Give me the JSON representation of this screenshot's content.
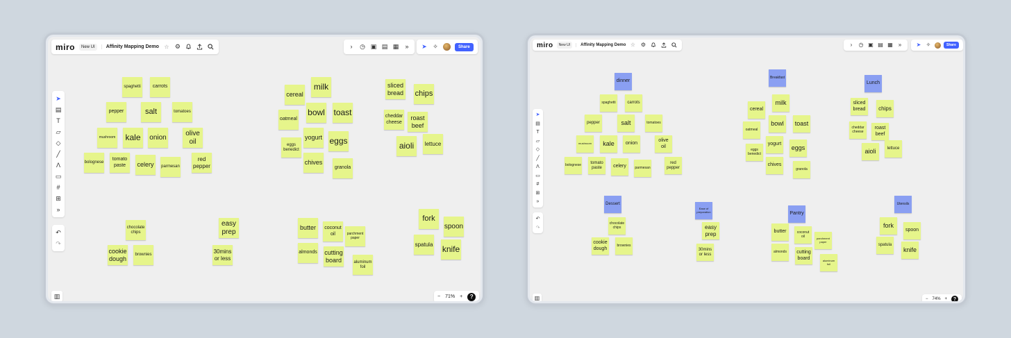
{
  "app": {
    "logo": "miro",
    "tag": "New UI",
    "board_title": "Affinity Mapping Demo",
    "share_label": "Share"
  },
  "icons": {
    "star": "☆",
    "settings": "⚙",
    "bell": "🔔",
    "upload": "⇪",
    "search": "⌕",
    "chevron_right": "›",
    "timer": "◷",
    "present": "▣",
    "comment": "▤",
    "notes": "▦",
    "more": "»",
    "cursor": "➤",
    "celebrate": "✧",
    "panel": "▥",
    "minus": "−",
    "plus": "+",
    "help": "?"
  },
  "colors": {
    "sticky_yellow": "#e6f58b",
    "sticky_blue": "#8a9ff2",
    "share_blue": "#4262ff",
    "canvas": "#efefef"
  },
  "tools": [
    "select",
    "frame",
    "text",
    "sticky-note",
    "shapes",
    "pen",
    "highlighter",
    "comment",
    "frame-grid",
    "upload",
    "more",
    "undo",
    "redo"
  ],
  "left": {
    "zoom": "71%",
    "notes": {
      "spaghetti": "spaghetti",
      "carrots": "carrots",
      "pepper": "pepper",
      "salt": "salt",
      "tomatoes": "tomatoes",
      "mushroom": "mushroom",
      "kale": "kale",
      "onion": "onion",
      "olive_oil": "olive\noil",
      "bolognese": "bolognese",
      "tomato_paste": "tomato\npaste",
      "celery": "celery",
      "parmesan": "parmesan",
      "red_pepper": "red\npepper",
      "cereal": "cereal",
      "milk": "milk",
      "oatmeal": "oatmeal",
      "bowl": "bowl",
      "toast": "toast",
      "eggs_benedict": "eggs\nbenedict",
      "yogurt": "yogurt",
      "eggs": "eggs",
      "chives": "chives",
      "granola": "granola",
      "sliced_bread": "sliced\nbread",
      "chips": "chips",
      "cheddar_cheese": "cheddar\ncheese",
      "roast_beef": "roast\nbeef",
      "aioli": "aioli",
      "lettuce": "lettuce",
      "chocolate_chips": "chocolate\nchips",
      "cookie_dough": "cookie\ndough",
      "brownies": "brownies",
      "easy_prep": "easy\nprep",
      "thirty_mins": "30mins\nor less",
      "butter": "butter",
      "coconut_oil": "coconut\noil",
      "parchment_paper": "parchment\npaper",
      "almonds": "almonds",
      "cutting_board": "cutting\nboard",
      "aluminum_foil": "aluminum\nfoil",
      "fork": "fork",
      "spoon": "spoon",
      "spatula": "spatula",
      "knife": "knife"
    }
  },
  "right": {
    "zoom": "74%",
    "headers": {
      "dinner": "dinner",
      "breakfast": "Breakfast",
      "lunch": "Lunch",
      "dessert": "Dessert",
      "ease_of_preparation": "Ease of\npreparation",
      "pantry": "Pantry",
      "utensils": "Utensils"
    },
    "notes": {
      "spaghetti": "spaghetti",
      "carrots": "carrots",
      "pepper": "pepper",
      "salt": "salt",
      "tomatoes": "tomatoes",
      "mushroom": "mushroom",
      "kale": "kale",
      "onion": "onion",
      "olive_oil": "olive\noil",
      "bolognese": "bolognese",
      "tomato_paste": "tomato\npaste",
      "celery": "celery",
      "parmesan": "parmesan",
      "red_pepper": "red\npepper",
      "cereal": "cereal",
      "milk": "milk",
      "oatmeal": "oatmeal",
      "bowl": "bowl",
      "toast": "toast",
      "eggs_benedict": "eggs\nbenedict",
      "yogurt": "yogurt",
      "eggs": "eggs",
      "chives": "chives",
      "granola": "granola",
      "sliced_bread": "sliced\nbread",
      "chips": "chips",
      "cheddar_cheese": "cheddar\ncheese",
      "roast_beef": "roast\nbeef",
      "aioli": "aioli",
      "lettuce": "lettuce",
      "chocolate_chips": "chocolate\nchips",
      "cookie_dough": "cookie\ndough",
      "brownies": "brownies",
      "easy_prep": "easy\nprep",
      "thirty_mins": "30mins\nor less",
      "butter": "butter",
      "coconut_oil": "coconut\noil",
      "parchment_paper": "parchment\npaper",
      "almonds": "almonds",
      "cutting_board": "cutting\nboard",
      "aluminum_foil": "aluminum\nfoil",
      "fork": "fork",
      "spoon": "spoon",
      "spatula": "spatula",
      "knife": "knife"
    }
  }
}
